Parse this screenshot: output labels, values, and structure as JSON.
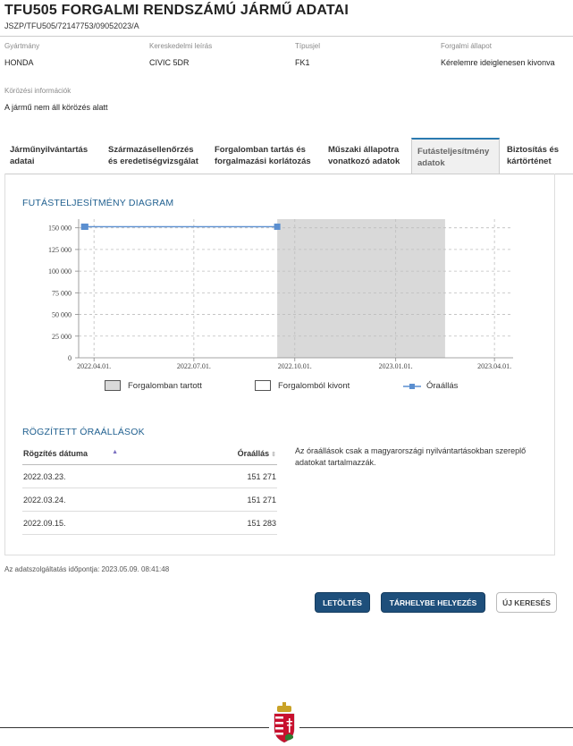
{
  "header": {
    "title": "TFU505 FORGALMI RENDSZÁMÚ JÁRMŰ ADATAI",
    "reference": "JSZP/TFU505/72147753/09052023/A"
  },
  "fields": {
    "manufacturer_label": "Gyártmány",
    "manufacturer_value": "HONDA",
    "description_label": "Kereskedelmi leírás",
    "description_value": "CIVIC 5DR",
    "type_label": "Típusjel",
    "type_value": "FK1",
    "status_label": "Forgalmi állapot",
    "status_value": "Kérelemre ideiglenesen kivonva",
    "wanted_label": "Körözési információk",
    "wanted_value": "A jármű nem áll körözés alatt"
  },
  "tabs": [
    {
      "line1": "Járműnyilvántartás",
      "line2": "adatai"
    },
    {
      "line1": "Származásellenőrzés",
      "line2": "és eredetiségvizsgálat"
    },
    {
      "line1": "Forgalomban tartás és",
      "line2": "forgalmazási korlátozás"
    },
    {
      "line1": "Műszaki állapotra",
      "line2": "vonatkozó adatok"
    },
    {
      "line1": "Futásteljesítmény",
      "line2": "adatok"
    },
    {
      "line1": "Biztosítás és",
      "line2": "kártörténet"
    }
  ],
  "chart_section_title": "FUTÁSTELJESÍTMÉNY DIAGRAM",
  "chart_data": {
    "type": "line",
    "x_tick_labels": [
      "2022.04.01.",
      "2022.07.01.",
      "2022.10.01.",
      "2023.01.01.",
      "2023.04.01."
    ],
    "y_tick_labels": [
      "0",
      "25 000",
      "50 000",
      "75 000",
      "100 000",
      "125 000",
      "150 000"
    ],
    "ylim": [
      0,
      160000
    ],
    "xlim": [
      "2022-03-18",
      "2023-04-18"
    ],
    "series": [
      {
        "name": "Óraállás",
        "color": "#5b8fd0",
        "points": [
          {
            "x": "2022-03-23",
            "y": 151271
          },
          {
            "x": "2022-03-24",
            "y": 151271
          },
          {
            "x": "2022-09-15",
            "y": 151283
          }
        ]
      }
    ],
    "shaded_range": {
      "name": "Forgalomban tartott",
      "from": "2022-09-15",
      "to": "2023-02-15",
      "color": "#d9d9d9"
    },
    "legend": [
      {
        "name": "Forgalomban tartott",
        "kind": "filled-box"
      },
      {
        "name": "Forgalomból kivont",
        "kind": "empty-box"
      },
      {
        "name": "Óraállás",
        "kind": "line-marker"
      }
    ],
    "grid": true
  },
  "records": {
    "title": "RÖGZÍTETT ÓRAÁLLÁSOK",
    "col_date": "Rögzítés dátuma",
    "col_value": "Óraállás",
    "rows": [
      {
        "date": "2022.03.23.",
        "value": "151 271"
      },
      {
        "date": "2022.03.24.",
        "value": "151 271"
      },
      {
        "date": "2022.09.15.",
        "value": "151 283"
      }
    ],
    "note": "Az óraállások csak a magyarországi nyilvántartásokban szereplő adatokat tartalmazzák."
  },
  "timestamp": "Az adatszolgáltatás időpontja: 2023.05.09. 08:41:48",
  "buttons": {
    "download": "LETÖLTÉS",
    "storage": "TÁRHELYBE HELYEZÉS",
    "new_search": "ÚJ KERESÉS"
  },
  "colors": {
    "accent": "#1e4f7b",
    "tab_active_border": "#2a7ab0",
    "section_title": "#1f5f8f"
  }
}
